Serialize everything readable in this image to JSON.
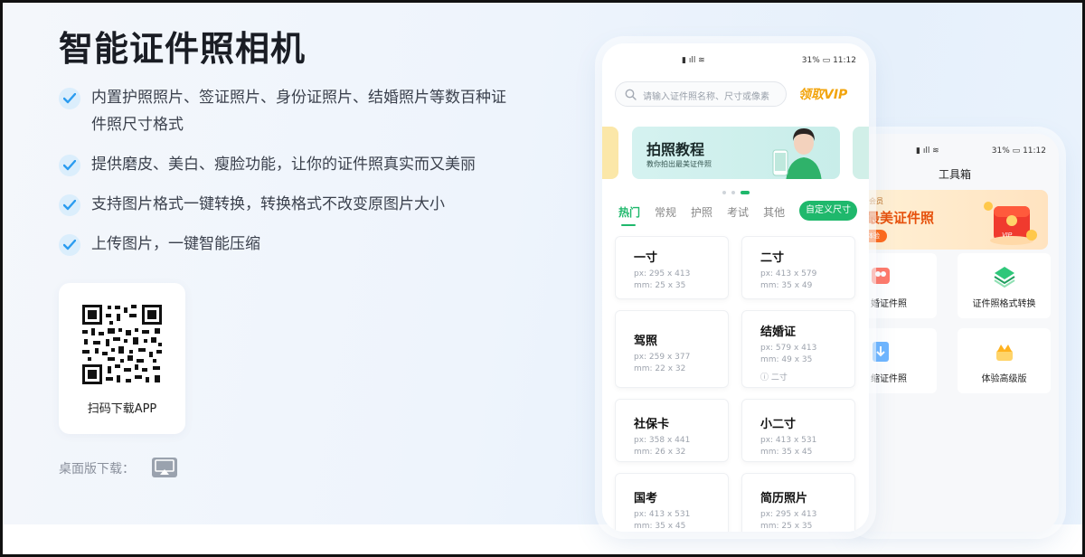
{
  "hero": {
    "title": "智能证件照相机",
    "features": [
      "内置护照照片、签证照片、身份证照片、结婚照片等数百种证件照尺寸格式",
      "提供磨皮、美白、瘦脸功能，让你的证件照真实而又美丽",
      "支持图片格式一键转换，转换格式不改变原图片大小",
      "上传图片，一键智能压缩"
    ],
    "qr_label": "扫码下载APP",
    "desktop_label": "桌面版下载："
  },
  "phone_main": {
    "status_time": "11:12",
    "status_battery": "31%",
    "search_placeholder": "请输入证件照名称、尺寸或像素",
    "vip_link": "领取VIP",
    "banner": {
      "title": "拍照教程",
      "subtitle": "教你拍出最美证件照"
    },
    "tabs": [
      "热门",
      "常规",
      "护照",
      "考试",
      "其他"
    ],
    "active_tab": "热门",
    "custom_size_button": "自定义尺寸",
    "sizes": [
      {
        "name": "一寸",
        "px": "px: 295 x 413",
        "mm": "mm: 25 x 35"
      },
      {
        "name": "二寸",
        "px": "px: 413 x 579",
        "mm": "mm: 35 x 49"
      },
      {
        "name": "驾照",
        "px": "px: 259 x 377",
        "mm": "mm: 22 x 32"
      },
      {
        "name": "结婚证",
        "px": "px: 579 x 413",
        "mm": "mm: 49 x 35",
        "note": "二寸"
      },
      {
        "name": "社保卡",
        "px": "px: 358 x 441",
        "mm": "mm: 26 x 32"
      },
      {
        "name": "小二寸",
        "px": "px: 413 x 531",
        "mm": "mm: 35 x 45"
      },
      {
        "name": "国考",
        "px": "px: 413 x 531",
        "mm": "mm: 35 x 45"
      },
      {
        "name": "简历照片",
        "px": "px: 295 x 413",
        "mm": "mm: 25 x 35"
      }
    ]
  },
  "phone_back": {
    "status_time": "11:12",
    "status_battery": "31%",
    "title": "工具箱",
    "promo_top": "级版会员",
    "promo_main": "锁最美证件照",
    "promo_button": "立即体验",
    "tools": [
      "婚证件照",
      "证件照格式转换",
      "缩证件照",
      "体验高级版"
    ]
  },
  "colors": {
    "accent_green": "#1fb86c",
    "vip_gold": "#f2a40c",
    "promo_orange": "#e6510c"
  }
}
